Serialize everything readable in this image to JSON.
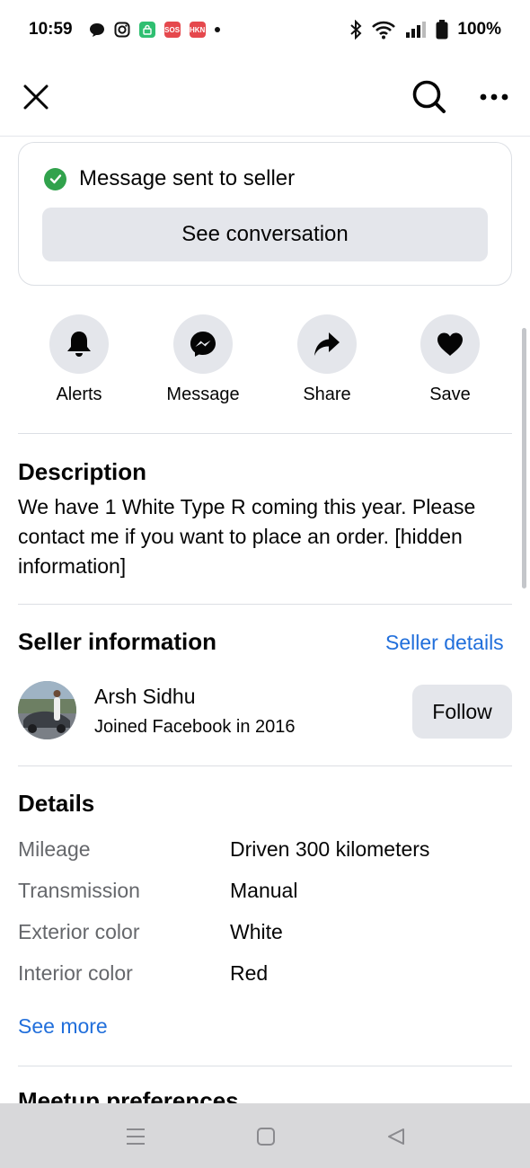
{
  "status_bar": {
    "time": "10:59",
    "battery": "100%",
    "badges": [
      "SOS",
      "HKN"
    ]
  },
  "top_bar": {
    "icons": [
      "close-icon",
      "search-icon",
      "more-icon"
    ]
  },
  "sent_card": {
    "message": "Message sent to seller",
    "button_label": "See conversation"
  },
  "actions": [
    {
      "label": "Alerts",
      "icon": "bell-icon"
    },
    {
      "label": "Message",
      "icon": "messenger-icon"
    },
    {
      "label": "Share",
      "icon": "share-icon"
    },
    {
      "label": "Save",
      "icon": "heart-icon"
    }
  ],
  "description": {
    "title": "Description",
    "text": "We have 1 White Type R coming this year. Please contact me if you want to place an order. [hidden information]"
  },
  "seller": {
    "title": "Seller information",
    "details_link": "Seller details",
    "name": "Arsh Sidhu",
    "joined": "Joined Facebook in 2016",
    "follow_label": "Follow"
  },
  "details": {
    "title": "Details",
    "rows": [
      {
        "label": "Mileage",
        "value": "Driven 300 kilometers"
      },
      {
        "label": "Transmission",
        "value": "Manual"
      },
      {
        "label": "Exterior color",
        "value": "White"
      },
      {
        "label": "Interior color",
        "value": "Red"
      }
    ],
    "see_more": "See more"
  },
  "next_section": {
    "title": "Meetup preferences"
  },
  "colors": {
    "accent": "#216fdb",
    "success": "#31a24c",
    "button_bg": "#e4e6eb"
  }
}
